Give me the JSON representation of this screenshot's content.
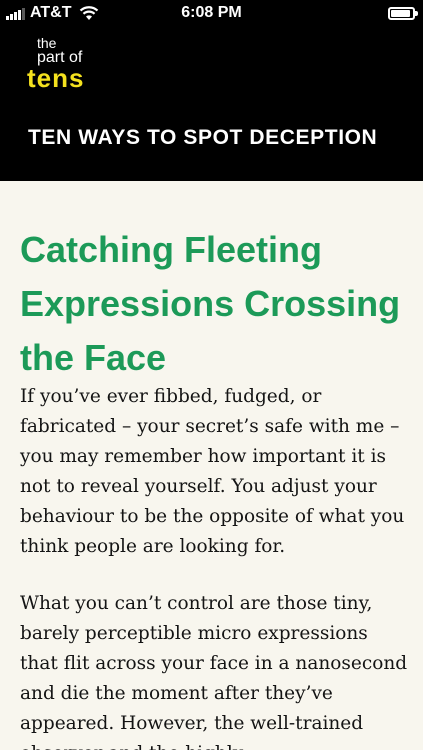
{
  "status": {
    "carrier": "AT&T",
    "time": "6:08 PM"
  },
  "header": {
    "logo": {
      "line1": "the",
      "line2": "part of",
      "line3": "tens"
    },
    "title": "TEN WAYS TO SPOT DECEPTION"
  },
  "article": {
    "title": "Catching Fleeting Expressions Crossing the Face",
    "paragraph1": "If you’ve ever fibbed, fudged, or fabricated – your secret’s safe with me – you may remember how important it is not to reveal yourself. You adjust your behaviour to be the opposite of what you think people are looking for.",
    "paragraph2": "What you can’t control are those tiny, barely perceptible micro expressions that flit across your face in a nanosecond and die the moment after they’ve appeared. However, the well-trained observer and the highly"
  },
  "colors": {
    "accent": "#1c9a58",
    "logo_tens": "#f4e11e",
    "background": "#f8f6ee",
    "header": "#000000"
  }
}
